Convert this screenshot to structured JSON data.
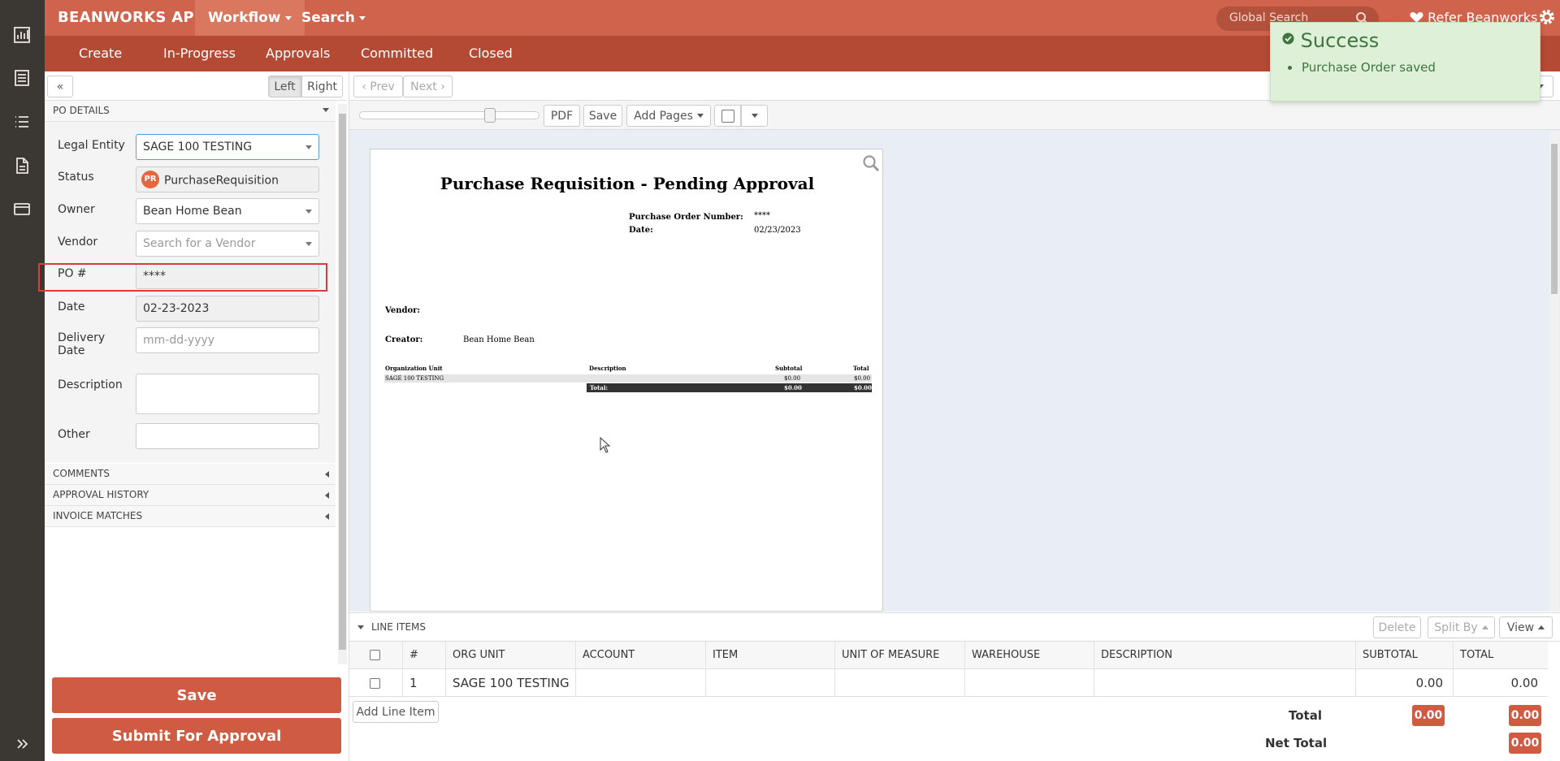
{
  "app": {
    "brand": "BEANWORKS AP"
  },
  "topnav": {
    "workflow": "Workflow",
    "search": "Search",
    "global_search_placeholder": "Global Search",
    "refer": "Refer Beanworks"
  },
  "subnav": [
    "Create",
    "In-Progress",
    "Approvals",
    "Committed",
    "Closed"
  ],
  "panel_controls": {
    "collapse": "«",
    "left": "Left",
    "right": "Right"
  },
  "sections": {
    "po_details": "PO DETAILS",
    "comments": "COMMENTS",
    "approval_history": "APPROVAL HISTORY",
    "invoice_matches": "INVOICE MATCHES",
    "line_items": "LINE ITEMS"
  },
  "form": {
    "legal_entity": {
      "label": "Legal Entity",
      "value": "SAGE 100 TESTING"
    },
    "status": {
      "label": "Status",
      "badge": "PR",
      "value": "PurchaseRequisition"
    },
    "owner": {
      "label": "Owner",
      "value": "Bean Home Bean"
    },
    "vendor": {
      "label": "Vendor",
      "placeholder": "Search for a Vendor"
    },
    "po_number": {
      "label": "PO #",
      "value": "****"
    },
    "date": {
      "label": "Date",
      "value": "02-23-2023"
    },
    "delivery_date": {
      "label_line1": "Delivery",
      "label_line2": "Date",
      "placeholder": "mm-dd-yyyy"
    },
    "description": {
      "label": "Description",
      "value": ""
    },
    "other": {
      "label": "Other",
      "value": ""
    }
  },
  "actions": {
    "save": "Save",
    "submit": "Submit For Approval"
  },
  "viewer": {
    "prev": "Prev",
    "next": "Next",
    "pdf": "PDF",
    "save": "Save",
    "add_pages": "Add Pages"
  },
  "document": {
    "title": "Purchase Requisition - Pending Approval",
    "po_number_label": "Purchase Order Number:",
    "po_number_value": "****",
    "date_label": "Date:",
    "date_value": "02/23/2023",
    "vendor_label": "Vendor:",
    "creator_label": "Creator:",
    "creator_value": "Bean Home Bean",
    "table_headers": [
      "Organization Unit",
      "Description",
      "Subtotal",
      "Total"
    ],
    "row": {
      "org_unit": "SAGE 100 TESTING",
      "subtotal": "$0.00",
      "total": "$0.00"
    },
    "total_row": {
      "label": "Total:",
      "subtotal": "$0.00",
      "total": "$0.00"
    }
  },
  "toast": {
    "title": "Success",
    "message": "Purchase Order saved"
  },
  "line_items": {
    "delete": "Delete",
    "split_by": "Split By",
    "view": "View",
    "columns": [
      "#",
      "ORG UNIT",
      "ACCOUNT",
      "ITEM",
      "UNIT OF MEASURE",
      "WAREHOUSE",
      "DESCRIPTION",
      "SUBTOTAL",
      "TOTAL"
    ],
    "rows": [
      {
        "num": "1",
        "org_unit": "SAGE 100 TESTING",
        "subtotal": "0.00",
        "total": "0.00"
      }
    ],
    "add_line": "Add Line Item",
    "total_label": "Total",
    "total_subtotal": "0.00",
    "total_total": "0.00",
    "net_total_label": "Net Total",
    "net_total": "0.00"
  },
  "colors": {
    "brand": "#cf634b",
    "subnav": "#b54a34",
    "rail": "#3b3733",
    "success_bg": "#dff0d8",
    "success_text": "#3c763d"
  }
}
